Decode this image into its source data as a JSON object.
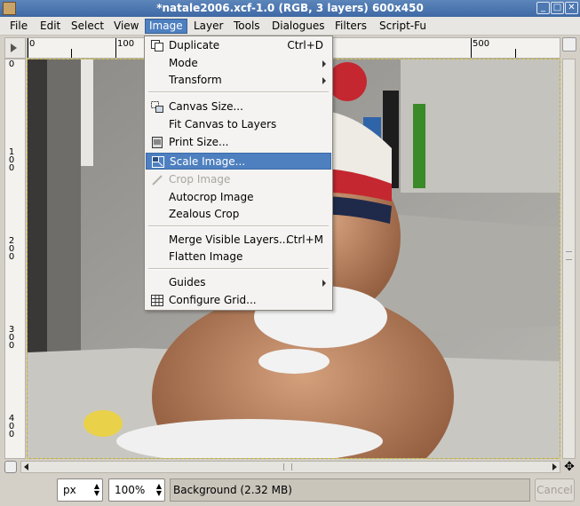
{
  "window": {
    "title": "*natale2006.xcf-1.0 (RGB, 3 layers) 600x450",
    "controls": {
      "minimize": "_",
      "maximize": "□",
      "close": "✕"
    }
  },
  "menubar": {
    "items": [
      "File",
      "Edit",
      "Select",
      "View",
      "Image",
      "Layer",
      "Tools",
      "Dialogues",
      "Filters",
      "Script-Fu"
    ],
    "active": "Image"
  },
  "ruler_top": {
    "labels": [
      "0",
      "100",
      "500"
    ]
  },
  "ruler_left": {
    "labels": [
      "0",
      "100",
      "200",
      "300",
      "400"
    ]
  },
  "image_menu": {
    "items": [
      {
        "label": "Duplicate",
        "accel": "Ctrl+D",
        "icon": "duplicate-icon"
      },
      {
        "label": "Mode",
        "submenu": true
      },
      {
        "label": "Transform",
        "submenu": true
      },
      {
        "label": "Canvas Size...",
        "icon": "canvas-size-icon"
      },
      {
        "label": "Fit Canvas to Layers"
      },
      {
        "label": "Print Size...",
        "icon": "print-size-icon"
      },
      {
        "label": "Scale Image...",
        "icon": "scale-image-icon",
        "highlighted": true
      },
      {
        "label": "Crop Image",
        "icon": "crop-icon",
        "disabled": true
      },
      {
        "label": "Autocrop Image"
      },
      {
        "label": "Zealous Crop"
      },
      {
        "label": "Merge Visible Layers...",
        "accel": "Ctrl+M"
      },
      {
        "label": "Flatten Image"
      },
      {
        "label": "Guides",
        "submenu": true
      },
      {
        "label": "Configure Grid...",
        "icon": "grid-icon"
      }
    ]
  },
  "statusbar": {
    "unit": "px",
    "zoom": "100%",
    "status": "Background (2.32 MB)",
    "cancel_label": "Cancel"
  },
  "colors": {
    "accent": "#4e80c0",
    "title_bar": "#3e69a5"
  }
}
